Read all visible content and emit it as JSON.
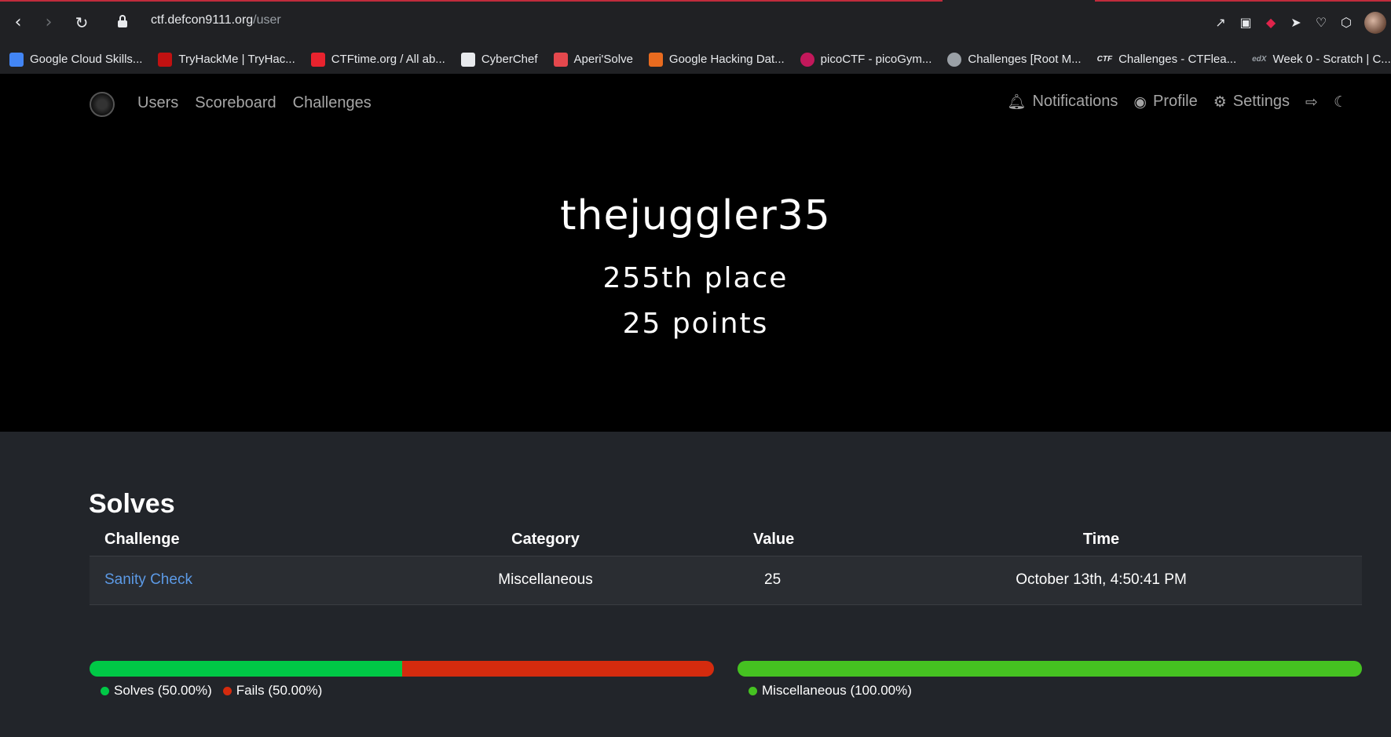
{
  "browser": {
    "url_host": "ctf.defcon9111.org",
    "url_path": "/user",
    "bookmarks": [
      {
        "label": "Google Cloud Skills...",
        "color": "#4285f4"
      },
      {
        "label": "TryHackMe | TryHac...",
        "color": "#c11111"
      },
      {
        "label": "CTFtime.org / All ab...",
        "color": "#e8232e"
      },
      {
        "label": "CyberChef",
        "color": "#e8eaed"
      },
      {
        "label": "Aperi'Solve",
        "color": "#e5484d"
      },
      {
        "label": "Google Hacking Dat...",
        "color": "#e86b1f"
      },
      {
        "label": "picoCTF - picoGym...",
        "color": "#c2185b"
      },
      {
        "label": "Challenges [Root M...",
        "color": "#9aa0a6"
      },
      {
        "label": "Challenges - CTFlea...",
        "color": "#e8eaed"
      },
      {
        "label": "Week 0 - Scratch | C...",
        "color": "#9aa0a6"
      }
    ],
    "bookmark_ctf_badge": "CTF",
    "bookmark_edx_badge": "edX"
  },
  "navbar": {
    "left": [
      "Users",
      "Scoreboard",
      "Challenges"
    ],
    "notifications": "Notifications",
    "profile": "Profile",
    "settings": "Settings"
  },
  "user": {
    "name": "thejuggler35",
    "place": "255th place",
    "points": "25 points"
  },
  "solves": {
    "title": "Solves",
    "headers": {
      "challenge": "Challenge",
      "category": "Category",
      "value": "Value",
      "time": "Time"
    },
    "rows": [
      {
        "challenge": "Sanity Check",
        "category": "Miscellaneous",
        "value": "25",
        "time": "October 13th, 4:50:41 PM"
      }
    ]
  },
  "charts": {
    "solve_percent": 50.0,
    "fail_percent": 50.0,
    "legend_solves": "Solves (50.00%)",
    "legend_fails": "Fails (50.00%)",
    "legend_misc": "Miscellaneous (100.00%)",
    "colors": {
      "solve": "#00c846",
      "fail": "#d42b0e",
      "misc": "#45c221"
    }
  }
}
